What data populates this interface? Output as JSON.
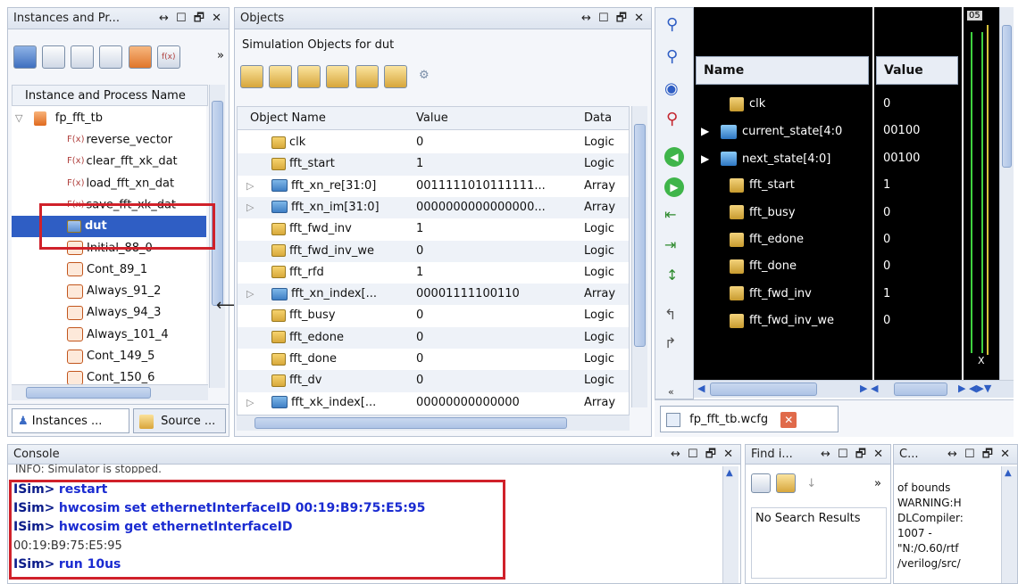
{
  "instances_panel": {
    "title": "Instances and Pr...",
    "controls": "↔ ☐ 🗗 ✕",
    "column_header": "Instance and Process Name",
    "root": "fp_fft_tb",
    "items": [
      {
        "label": "reverse_vector",
        "kind": "fx"
      },
      {
        "label": "clear_fft_xk_dat",
        "kind": "fx"
      },
      {
        "label": "load_fft_xn_dat",
        "kind": "fx"
      },
      {
        "label": "save_fft_xk_dat",
        "kind": "fx"
      },
      {
        "label": "dut",
        "kind": "dut"
      },
      {
        "label": "Initial_88_0",
        "kind": "proc"
      },
      {
        "label": "Cont_89_1",
        "kind": "proc"
      },
      {
        "label": "Always_91_2",
        "kind": "proc"
      },
      {
        "label": "Always_94_3",
        "kind": "proc"
      },
      {
        "label": "Always_101_4",
        "kind": "proc"
      },
      {
        "label": "Cont_149_5",
        "kind": "proc"
      },
      {
        "label": "Cont_150_6",
        "kind": "proc"
      }
    ],
    "tabs": [
      "Instances ...",
      "Source ..."
    ],
    "toolbar_more": "»"
  },
  "objects_panel": {
    "title": "Objects",
    "controls": "↔ ☐ 🗗 ✕",
    "subtitle": "Simulation Objects for dut",
    "columns": [
      "Object Name",
      "Value",
      "Data"
    ],
    "rows": [
      {
        "name": "clk",
        "value": "0",
        "type": "Logic",
        "expandable": false
      },
      {
        "name": "fft_start",
        "value": "1",
        "type": "Logic",
        "expandable": false
      },
      {
        "name": "fft_xn_re[31:0]",
        "value": "0011111010111111...",
        "type": "Array",
        "expandable": true
      },
      {
        "name": "fft_xn_im[31:0]",
        "value": "0000000000000000...",
        "type": "Array",
        "expandable": true
      },
      {
        "name": "fft_fwd_inv",
        "value": "1",
        "type": "Logic",
        "expandable": false
      },
      {
        "name": "fft_fwd_inv_we",
        "value": "0",
        "type": "Logic",
        "expandable": false
      },
      {
        "name": "fft_rfd",
        "value": "1",
        "type": "Logic",
        "expandable": false
      },
      {
        "name": "fft_xn_index[...",
        "value": "00001111100110",
        "type": "Array",
        "expandable": true
      },
      {
        "name": "fft_busy",
        "value": "0",
        "type": "Logic",
        "expandable": false
      },
      {
        "name": "fft_edone",
        "value": "0",
        "type": "Logic",
        "expandable": false
      },
      {
        "name": "fft_done",
        "value": "0",
        "type": "Logic",
        "expandable": false
      },
      {
        "name": "fft_dv",
        "value": "0",
        "type": "Logic",
        "expandable": false
      },
      {
        "name": "fft_xk_index[...",
        "value": "00000000000000",
        "type": "Array",
        "expandable": true
      }
    ]
  },
  "wave_panel": {
    "columns": [
      "Name",
      "Value"
    ],
    "rows": [
      {
        "name": "clk",
        "value": "0",
        "expandable": false,
        "array": false
      },
      {
        "name": "current_state[4:0",
        "value": "00100",
        "expandable": true,
        "array": true
      },
      {
        "name": "next_state[4:0]",
        "value": "00100",
        "expandable": true,
        "array": true
      },
      {
        "name": "fft_start",
        "value": "1",
        "expandable": false,
        "array": false
      },
      {
        "name": "fft_busy",
        "value": "0",
        "expandable": false,
        "array": false
      },
      {
        "name": "fft_edone",
        "value": "0",
        "expandable": false,
        "array": false
      },
      {
        "name": "fft_done",
        "value": "0",
        "expandable": false,
        "array": false
      },
      {
        "name": "fft_fwd_inv",
        "value": "1",
        "expandable": false,
        "array": false
      },
      {
        "name": "fft_fwd_inv_we",
        "value": "0",
        "expandable": false,
        "array": false
      }
    ],
    "tab_label": "fp_fft_tb.wcfg",
    "corner_label": "05",
    "x_marker": "X"
  },
  "console_panel": {
    "title": "Console",
    "controls": "↔ ☐ 🗗 ✕",
    "first_line": "INFO: Simulator is stopped.",
    "prompt": "ISim>",
    "lines": [
      {
        "kind": "cmd",
        "text": "restart"
      },
      {
        "kind": "cmd",
        "text": "hwcosim set ethernetInterfaceID  00:19:B9:75:E5:95"
      },
      {
        "kind": "cmd",
        "text": "hwcosim get ethernetInterfaceID"
      },
      {
        "kind": "out",
        "text": "00:19:B9:75:E5:95"
      },
      {
        "kind": "cmd",
        "text": "run 10us"
      }
    ]
  },
  "find_panel": {
    "title": "Find i...",
    "controls": "↔ ☐ 🗗 ✕",
    "result": "No Search Results",
    "more": "»"
  },
  "compile_panel": {
    "title": "C...",
    "controls": "↔ ☐ 🗗 ✕",
    "lines": [
      "of bounds",
      "WARNING:H",
      "DLCompiler:",
      "1007 -",
      "\"N:/O.60/rtf",
      "/verilog/src/"
    ]
  },
  "colors": {
    "highlight_box": "#d0212a",
    "selected_row": "#2f5ec4",
    "wave_bg": "#000000",
    "wave_green": "#3fd13f"
  }
}
